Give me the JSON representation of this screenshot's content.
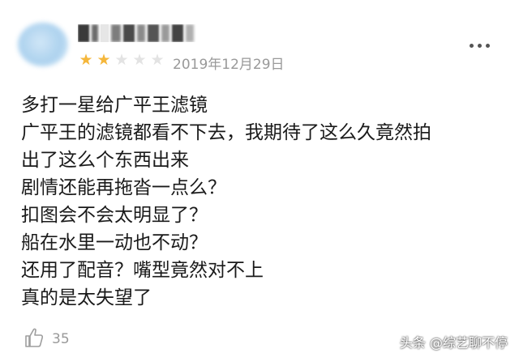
{
  "comment": {
    "user": {
      "name": "▇▇ ▇▇▇▇▇",
      "avatar_icon": "blurred-avatar"
    },
    "rating": {
      "filled": 2,
      "total": 5,
      "filled_color": "#f5b73b",
      "empty_color": "#e3e3e3"
    },
    "date": "2019年12月29日",
    "more_icon": "three-dots-icon",
    "lines": [
      " 多打一星给广平王滤镜",
      "广平王的滤镜都看不下去，我期待了这么久竟然拍",
      "出了这么个东西出来",
      "剧情还能再拖沓一点么？",
      "扣图会不会太明显了？",
      "船在水里一动也不动？",
      "还用了配音？嘴型竟然对不上",
      "真的是太失望了"
    ],
    "likes": {
      "icon": "thumbs-up-icon",
      "count": "35"
    }
  },
  "watermark": "头条 @综艺聊不停"
}
